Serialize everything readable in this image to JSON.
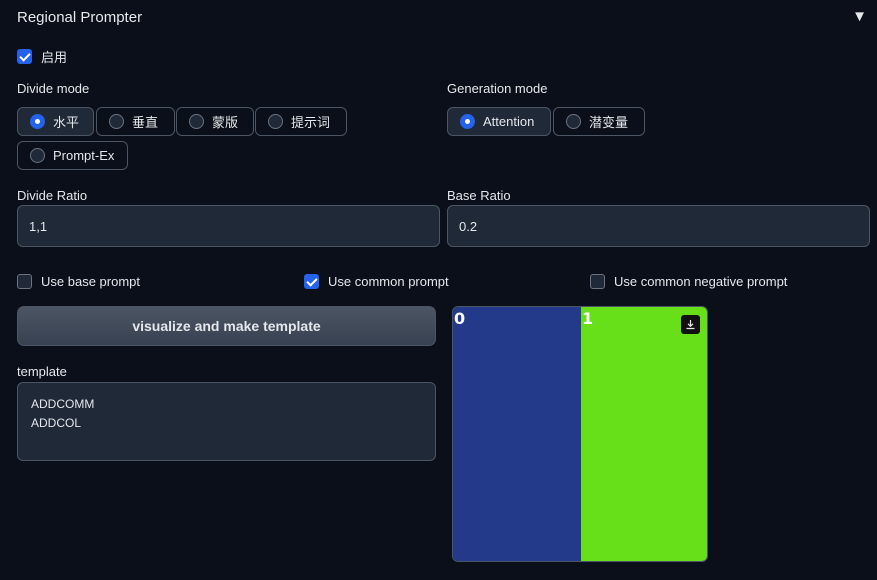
{
  "header": {
    "title": "Regional Prompter",
    "toggle_icon": "triangle-down"
  },
  "enable": {
    "label": "启用",
    "checked": true
  },
  "divide_mode": {
    "label": "Divide mode",
    "options": [
      "水平",
      "垂直",
      "蒙版",
      "提示词",
      "Prompt-Ex"
    ],
    "selected": "水平"
  },
  "generation_mode": {
    "label": "Generation mode",
    "options": [
      "Attention",
      "潜变量"
    ],
    "selected": "Attention"
  },
  "divide_ratio": {
    "label": "Divide Ratio",
    "value": "1,1"
  },
  "base_ratio": {
    "label": "Base Ratio",
    "value": "0.2"
  },
  "checkboxes": {
    "use_base_prompt": {
      "label": "Use base prompt",
      "checked": false
    },
    "use_common_prompt": {
      "label": "Use common prompt",
      "checked": true
    },
    "use_common_negative_prompt": {
      "label": "Use common negative prompt",
      "checked": false
    }
  },
  "visualize_button": {
    "label": "visualize and make template"
  },
  "template": {
    "label": "template",
    "lines": [
      "ADDCOMM",
      "ADDCOL"
    ]
  },
  "preview": {
    "regions": [
      {
        "label": "0",
        "color": "#233a8a",
        "width_ratio": 0.5
      },
      {
        "label": "1",
        "color": "#67e01a",
        "width_ratio": 0.5
      }
    ],
    "download_icon": "download-icon"
  },
  "colors": {
    "accent": "#2563eb",
    "background": "#0b0f19",
    "input_bg": "#1f2937"
  }
}
